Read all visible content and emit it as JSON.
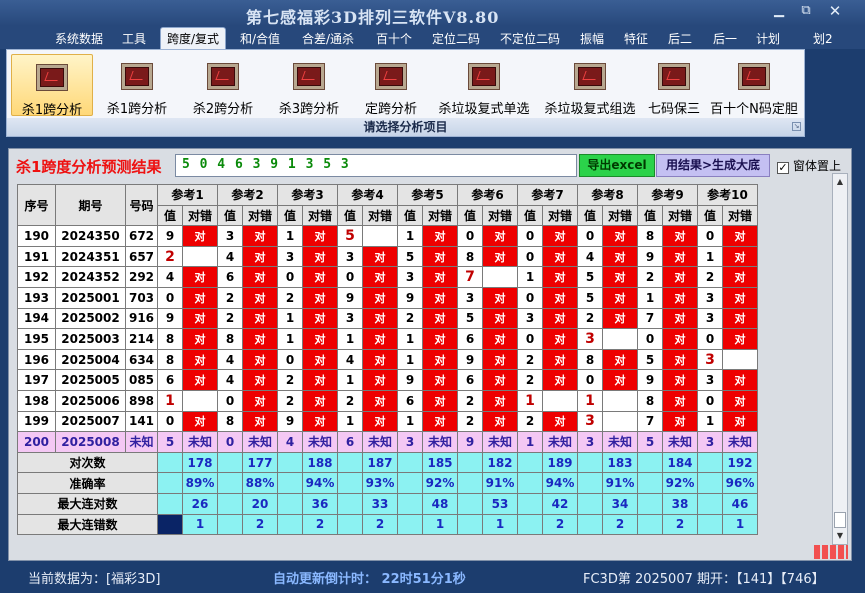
{
  "app_title": "第七感福彩3D排列三软件V8.80",
  "window_buttons": {
    "minimize": "▁",
    "maximize": "⧉",
    "close": "✕"
  },
  "menu": [
    "系统数据",
    "工具",
    "跨度/复式",
    "和/合值",
    "合差/通杀",
    "百十个",
    "定位二码",
    "不定位二码",
    "振幅",
    "特征",
    "后二",
    "后一",
    "计划",
    "划2"
  ],
  "menu_active": 2,
  "ribbon": {
    "buttons": [
      "杀1跨分析",
      "杀1跨分析",
      "杀2跨分析",
      "杀3跨分析",
      "定跨分析",
      "杀垃圾复式单选",
      "杀垃圾复式组选",
      "七码保三",
      "百十个N码定胆"
    ],
    "selected": 0,
    "group_label": "请选择分析项目"
  },
  "result": {
    "title": "杀1跨度分析预测结果",
    "value": "5 0 4 6 3 9 1 3 5 3",
    "export_button": "导出excel",
    "generate_button": "用结果>生成大底",
    "pin_label": "窗体置上",
    "pin_checked": "✓"
  },
  "table": {
    "headers": {
      "index": "序号",
      "period": "期号",
      "number": "号码",
      "value": "值",
      "result": "对错"
    },
    "refs": [
      "参考1",
      "参考2",
      "参考3",
      "参考4",
      "参考5",
      "参考6",
      "参考7",
      "参考8",
      "参考9",
      "参考10"
    ],
    "hit_text": "对",
    "unknown_text": "未知",
    "rows": [
      {
        "index": "190",
        "period": "2024350",
        "number": "672",
        "cells": [
          [
            "9",
            "h"
          ],
          [
            "3",
            "h"
          ],
          [
            "1",
            "h"
          ],
          [
            "5",
            "m"
          ],
          [
            "1",
            "h"
          ],
          [
            "0",
            "h"
          ],
          [
            "0",
            "h"
          ],
          [
            "0",
            "h"
          ],
          [
            "8",
            "h"
          ],
          [
            "0",
            "h"
          ]
        ]
      },
      {
        "index": "191",
        "period": "2024351",
        "number": "657",
        "cells": [
          [
            "2",
            "m"
          ],
          [
            "4",
            "h"
          ],
          [
            "3",
            "h"
          ],
          [
            "3",
            "h"
          ],
          [
            "5",
            "h"
          ],
          [
            "8",
            "h"
          ],
          [
            "0",
            "h"
          ],
          [
            "4",
            "h"
          ],
          [
            "9",
            "h"
          ],
          [
            "1",
            "h"
          ]
        ]
      },
      {
        "index": "192",
        "period": "2024352",
        "number": "292",
        "cells": [
          [
            "4",
            "h"
          ],
          [
            "6",
            "h"
          ],
          [
            "0",
            "h"
          ],
          [
            "0",
            "h"
          ],
          [
            "3",
            "h"
          ],
          [
            "7",
            "m"
          ],
          [
            "1",
            "h"
          ],
          [
            "5",
            "h"
          ],
          [
            "2",
            "h"
          ],
          [
            "2",
            "h"
          ]
        ]
      },
      {
        "index": "193",
        "period": "2025001",
        "number": "703",
        "cells": [
          [
            "0",
            "h"
          ],
          [
            "2",
            "h"
          ],
          [
            "2",
            "h"
          ],
          [
            "9",
            "h"
          ],
          [
            "9",
            "h"
          ],
          [
            "3",
            "h"
          ],
          [
            "0",
            "h"
          ],
          [
            "5",
            "h"
          ],
          [
            "1",
            "h"
          ],
          [
            "3",
            "h"
          ]
        ]
      },
      {
        "index": "194",
        "period": "2025002",
        "number": "916",
        "cells": [
          [
            "9",
            "h"
          ],
          [
            "2",
            "h"
          ],
          [
            "1",
            "h"
          ],
          [
            "3",
            "h"
          ],
          [
            "2",
            "h"
          ],
          [
            "5",
            "h"
          ],
          [
            "3",
            "h"
          ],
          [
            "2",
            "h"
          ],
          [
            "7",
            "h"
          ],
          [
            "3",
            "h"
          ]
        ]
      },
      {
        "index": "195",
        "period": "2025003",
        "number": "214",
        "cells": [
          [
            "8",
            "h"
          ],
          [
            "8",
            "h"
          ],
          [
            "1",
            "h"
          ],
          [
            "1",
            "h"
          ],
          [
            "1",
            "h"
          ],
          [
            "6",
            "h"
          ],
          [
            "0",
            "h"
          ],
          [
            "3",
            "m"
          ],
          [
            "0",
            "h"
          ],
          [
            "0",
            "h"
          ]
        ]
      },
      {
        "index": "196",
        "period": "2025004",
        "number": "634",
        "cells": [
          [
            "8",
            "h"
          ],
          [
            "4",
            "h"
          ],
          [
            "0",
            "h"
          ],
          [
            "4",
            "h"
          ],
          [
            "1",
            "h"
          ],
          [
            "9",
            "h"
          ],
          [
            "2",
            "h"
          ],
          [
            "8",
            "h"
          ],
          [
            "5",
            "h"
          ],
          [
            "3",
            "m"
          ]
        ]
      },
      {
        "index": "197",
        "period": "2025005",
        "number": "085",
        "cells": [
          [
            "6",
            "h"
          ],
          [
            "4",
            "h"
          ],
          [
            "2",
            "h"
          ],
          [
            "1",
            "h"
          ],
          [
            "9",
            "h"
          ],
          [
            "6",
            "h"
          ],
          [
            "2",
            "h"
          ],
          [
            "0",
            "h"
          ],
          [
            "9",
            "h"
          ],
          [
            "3",
            "h"
          ]
        ]
      },
      {
        "index": "198",
        "period": "2025006",
        "number": "898",
        "cells": [
          [
            "1",
            "m"
          ],
          [
            "0",
            "h"
          ],
          [
            "2",
            "h"
          ],
          [
            "2",
            "h"
          ],
          [
            "6",
            "h"
          ],
          [
            "2",
            "h"
          ],
          [
            "1",
            "m"
          ],
          [
            "1",
            "m"
          ],
          [
            "8",
            "h"
          ],
          [
            "0",
            "h"
          ]
        ]
      },
      {
        "index": "199",
        "period": "2025007",
        "number": "141",
        "cells": [
          [
            "0",
            "h"
          ],
          [
            "8",
            "h"
          ],
          [
            "9",
            "h"
          ],
          [
            "1",
            "h"
          ],
          [
            "1",
            "h"
          ],
          [
            "2",
            "h"
          ],
          [
            "2",
            "h"
          ],
          [
            "3",
            "m"
          ],
          [
            "7",
            "h"
          ],
          [
            "1",
            "h"
          ]
        ]
      }
    ],
    "unknown_row": {
      "index": "200",
      "period": "2025008",
      "number": "未知",
      "values": [
        "5",
        "0",
        "4",
        "6",
        "3",
        "9",
        "1",
        "3",
        "5",
        "3"
      ]
    },
    "stats": [
      {
        "label": "对次数",
        "values": [
          "178",
          "177",
          "188",
          "187",
          "185",
          "182",
          "189",
          "183",
          "184",
          "192"
        ]
      },
      {
        "label": "准确率",
        "values": [
          "89%",
          "88%",
          "94%",
          "93%",
          "92%",
          "91%",
          "94%",
          "91%",
          "92%",
          "96%"
        ]
      },
      {
        "label": "最大连对数",
        "values": [
          "26",
          "20",
          "36",
          "33",
          "48",
          "53",
          "42",
          "34",
          "38",
          "46"
        ]
      },
      {
        "label": "最大连错数",
        "values": [
          "1",
          "2",
          "2",
          "2",
          "1",
          "1",
          "2",
          "2",
          "2",
          "1"
        ]
      }
    ]
  },
  "status": {
    "current_data": "当前数据为：[福彩3D]",
    "countdown": "自动更新倒计时：  22时51分1秒",
    "issue": "FC3D第 2025007 期开：【141】【746】"
  },
  "colors": {
    "hit": "#ee0000",
    "stats_bg": "#8cf2f2",
    "unknown_bg": "#f4c8f4",
    "title_red": "#ee1111"
  }
}
